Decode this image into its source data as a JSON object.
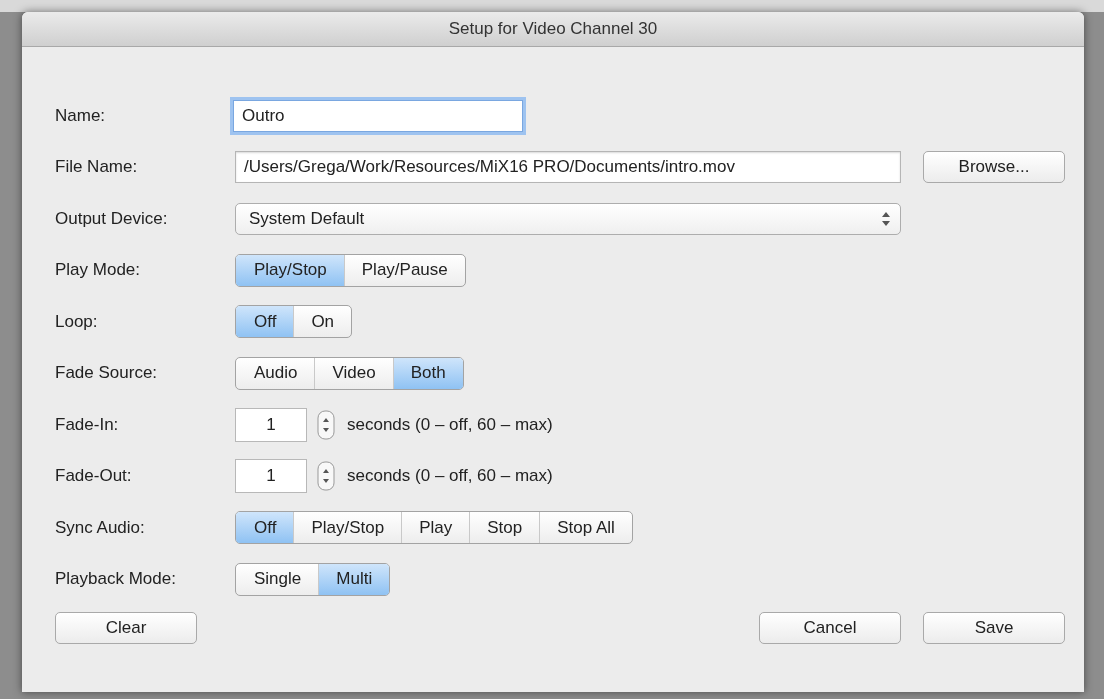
{
  "window": {
    "title": "Setup for Video Channel 30"
  },
  "fields": [
    {
      "kind": "text",
      "label": "Name:",
      "value": "Outro",
      "focused": true
    },
    {
      "kind": "file",
      "label": "File Name:",
      "value": "/Users/Grega/Work/Resources/MiX16 PRO/Documents/intro.mov",
      "button": "Browse..."
    },
    {
      "kind": "popup",
      "label": "Output Device:",
      "value": "System Default"
    },
    {
      "kind": "segmented",
      "label": "Play Mode:",
      "options": [
        {
          "label": "Play/Stop",
          "selected": true
        },
        {
          "label": "Play/Pause",
          "selected": false
        }
      ]
    },
    {
      "kind": "segmented",
      "label": "Loop:",
      "options": [
        {
          "label": "Off",
          "selected": true
        },
        {
          "label": "On",
          "selected": false
        }
      ]
    },
    {
      "kind": "segmented",
      "label": "Fade Source:",
      "options": [
        {
          "label": "Audio",
          "selected": false
        },
        {
          "label": "Video",
          "selected": false
        },
        {
          "label": "Both",
          "selected": true
        }
      ]
    },
    {
      "kind": "stepper",
      "label": "Fade-In:",
      "value": "1",
      "hint": "seconds (0 – off, 60 – max)"
    },
    {
      "kind": "stepper",
      "label": "Fade-Out:",
      "value": "1",
      "hint": "seconds (0 – off, 60 – max)"
    },
    {
      "kind": "segmented",
      "label": "Sync Audio:",
      "options": [
        {
          "label": "Off",
          "selected": true
        },
        {
          "label": "Play/Stop",
          "selected": false
        },
        {
          "label": "Play",
          "selected": false
        },
        {
          "label": "Stop",
          "selected": false
        },
        {
          "label": "Stop All",
          "selected": false
        }
      ]
    },
    {
      "kind": "segmented",
      "label": "Playback Mode:",
      "options": [
        {
          "label": "Single",
          "selected": false
        },
        {
          "label": "Multi",
          "selected": true
        }
      ]
    }
  ],
  "left_buttons": [
    "Clear"
  ],
  "right_buttons": [
    "Cancel",
    "Save"
  ]
}
